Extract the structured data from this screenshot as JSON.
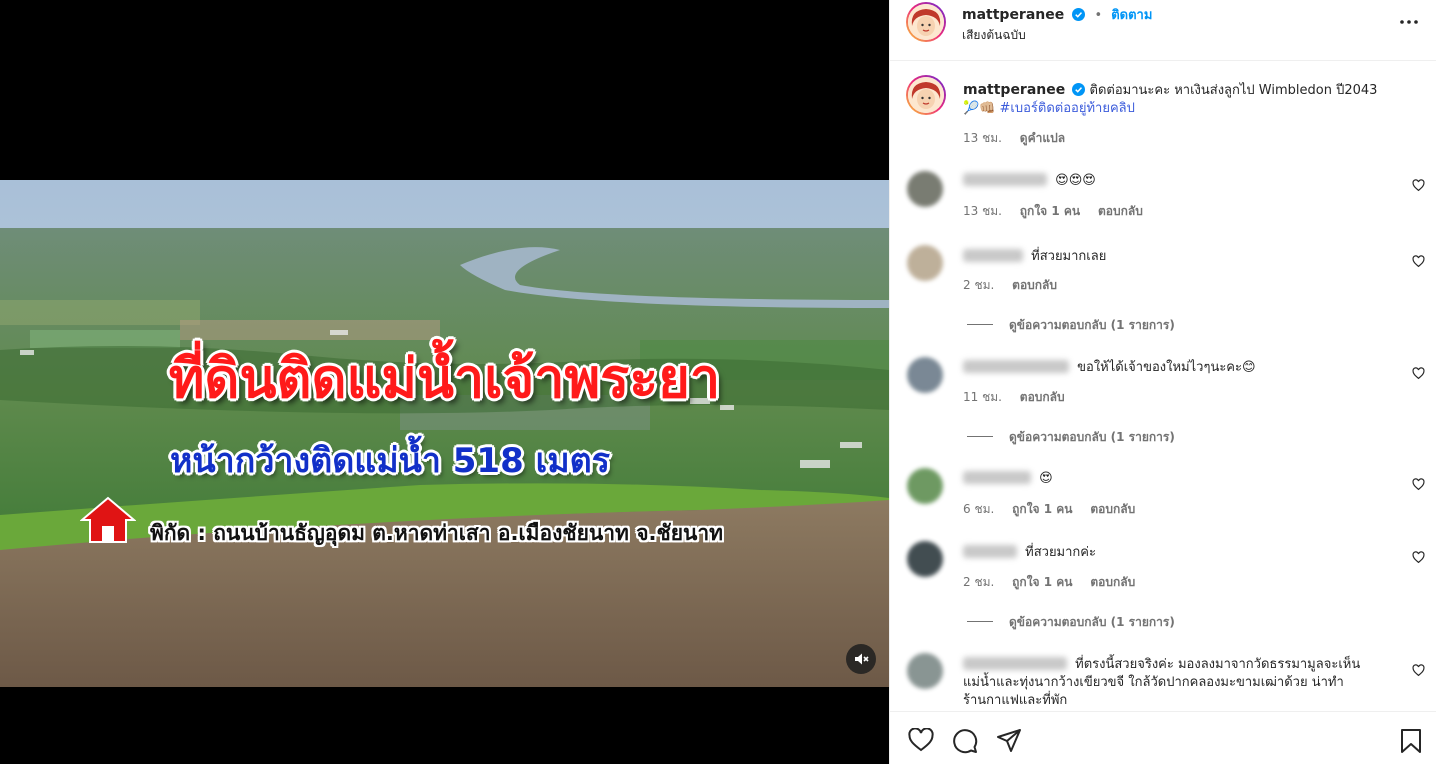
{
  "video": {
    "title": "ที่ดินติดแม่น้ำเจ้าพระยา",
    "subtitle": "หน้ากว้างติดแม่น้ำ 518 เมตร",
    "location": "พิกัด : ถนนบ้านธัญอุดม ต.หาดท่าเสา อ.เมืองชัยนาท จ.ชัยนาท"
  },
  "header": {
    "username": "mattperanee",
    "separator": "•",
    "follow_label": "ติดตาม",
    "audio_label": "เสียงต้นฉบับ"
  },
  "caption": {
    "username": "mattperanee",
    "text": "ติดต่อมานะคะ หาเงินส่งลูกไป Wimbledon ปี2043",
    "emoji": "🎾👊🏼",
    "hashtag": "#เบอร์ติดต่ออยู่ท้ายคลิป",
    "time": "13 ชม.",
    "translate": "ดูคำแปล"
  },
  "comments": [
    {
      "text": "😍😍😍",
      "time": "13 ชม.",
      "likes": "ถูกใจ 1 คน",
      "reply": "ตอบกลับ",
      "view_replies": ""
    },
    {
      "text": "ที่สวยมากเลย",
      "time": "2 ชม.",
      "likes": "",
      "reply": "ตอบกลับ",
      "view_replies": "ดูข้อความตอบกลับ (1 รายการ)"
    },
    {
      "text": "ขอให้ได้เจ้าของใหม่ไวๆนะคะ😊",
      "time": "11 ชม.",
      "likes": "",
      "reply": "ตอบกลับ",
      "view_replies": "ดูข้อความตอบกลับ (1 รายการ)"
    },
    {
      "text": "😍",
      "time": "6 ชม.",
      "likes": "ถูกใจ 1 คน",
      "reply": "ตอบกลับ",
      "view_replies": ""
    },
    {
      "text": "ที่สวยมากค่ะ",
      "time": "2 ชม.",
      "likes": "ถูกใจ 1 คน",
      "reply": "ตอบกลับ",
      "view_replies": "ดูข้อความตอบกลับ (1 รายการ)"
    },
    {
      "text": "ที่ตรงนี้สวยจริงค่ะ มองลงมาจากวัดธรรมามูลจะเห็น",
      "text2": "แม่น้ำและทุ่งนากว้างเขียวขจี ใกล้วัดปากคลองมะขามเฒ่าด้วย น่าทำ",
      "text3": "ร้านกาแฟและที่พัก",
      "time": "",
      "likes": "",
      "reply": "",
      "view_replies": ""
    }
  ],
  "icons": {
    "like": "heart-icon",
    "comment": "comment-icon",
    "share": "send-icon",
    "save": "bookmark-icon",
    "more": "more-icon",
    "mute": "muted-speaker-icon",
    "verified": "verified-badge-icon",
    "location": "house-icon"
  },
  "colors": {
    "accent": "#0095f6",
    "title_red": "#ff1a1a",
    "subtitle_blue": "#1230c8",
    "hashtag": "#3b5bdb"
  }
}
